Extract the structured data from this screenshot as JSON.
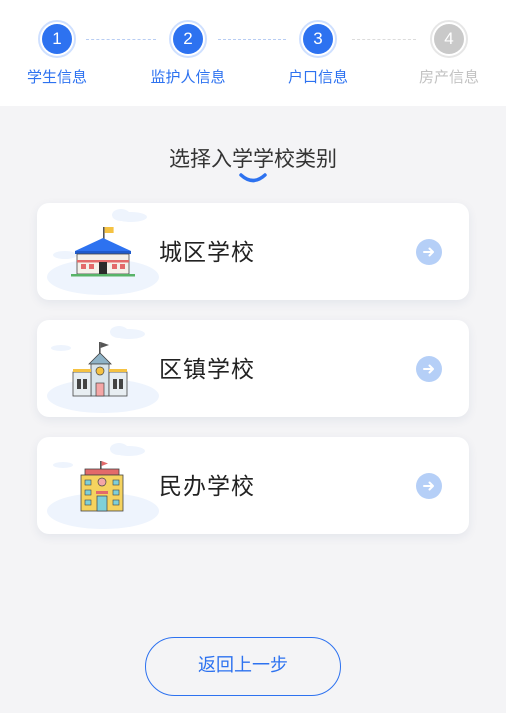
{
  "stepper": {
    "steps": [
      {
        "number": "1",
        "label": "学生信息",
        "state": "active"
      },
      {
        "number": "2",
        "label": "监护人信息",
        "state": "active"
      },
      {
        "number": "3",
        "label": "户口信息",
        "state": "active"
      },
      {
        "number": "4",
        "label": "房产信息",
        "state": "inactive"
      }
    ]
  },
  "heading": "选择入学学校类别",
  "school_types": [
    {
      "title": "城区学校",
      "icon": "city-school-icon"
    },
    {
      "title": "区镇学校",
      "icon": "town-school-icon"
    },
    {
      "title": "民办学校",
      "icon": "private-school-icon"
    }
  ],
  "back_button": {
    "label": "返回上一步"
  },
  "colors": {
    "accent": "#2d72f0",
    "inactive": "#c9c9c9",
    "arrow_bg": "#b5cff7",
    "background": "#f4f4f6"
  }
}
